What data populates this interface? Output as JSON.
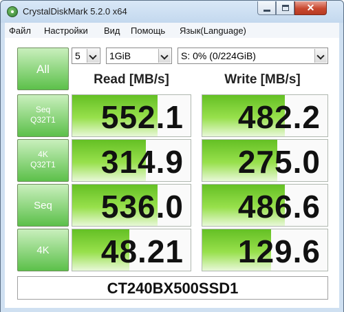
{
  "window": {
    "title": "CrystalDiskMark 5.2.0 x64",
    "close_glyph": "✕"
  },
  "menu": [
    {
      "label": "Файл"
    },
    {
      "label": "Настройки"
    },
    {
      "label": "Вид"
    },
    {
      "label": "Помощь"
    },
    {
      "label": "Язык(Language)"
    }
  ],
  "controls": {
    "all_label": "All",
    "count": "5",
    "size": "1GiB",
    "drive": "S: 0% (0/224GiB)"
  },
  "headers": {
    "read": "Read [MB/s]",
    "write": "Write [MB/s]"
  },
  "rows": [
    {
      "label_line1": "Seq",
      "label_line2": "Q32T1",
      "read": "552.1",
      "write": "482.2",
      "read_fill": 0.72,
      "write_fill": 0.66
    },
    {
      "label_line1": "4K",
      "label_line2": "Q32T1",
      "read": "314.9",
      "write": "275.0",
      "read_fill": 0.62,
      "write_fill": 0.6
    },
    {
      "label_line1": "Seq",
      "label_line2": "",
      "read": "536.0",
      "write": "486.6",
      "read_fill": 0.72,
      "write_fill": 0.66
    },
    {
      "label_line1": "4K",
      "label_line2": "",
      "read": "48.21",
      "write": "129.6",
      "read_fill": 0.48,
      "write_fill": 0.55
    }
  ],
  "comment": "CT240BX500SSD1",
  "colors": {
    "bar": "#64c024",
    "button": "#5cc04a"
  }
}
